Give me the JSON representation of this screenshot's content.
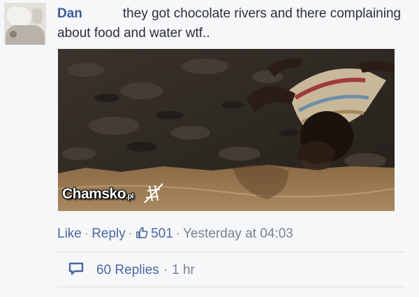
{
  "comment": {
    "author": "Dan",
    "text": "they got chocolate rivers and there complaining about food and water wtf.."
  },
  "image": {
    "watermark": "Chamsko",
    "watermark_suffix": ".pl"
  },
  "actions": {
    "like": "Like",
    "reply": "Reply",
    "like_count": "501",
    "timestamp": "Yesterday at 04:03"
  },
  "replies": {
    "label": "60 Replies",
    "time": "1 hr"
  },
  "icons": {
    "like": "thumbs-up-icon",
    "replies": "speech-bubble-icon"
  },
  "colors": {
    "link": "#4b67a1",
    "author": "#3b5998",
    "meta": "#7b8190"
  }
}
